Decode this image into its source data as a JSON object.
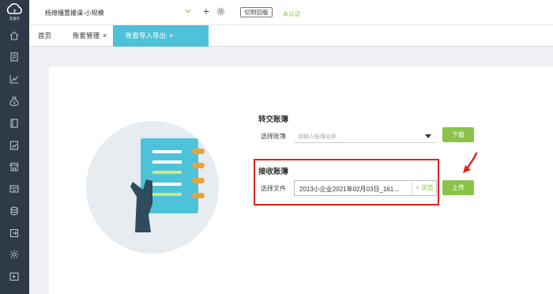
{
  "app": {
    "logo_text": "云会计",
    "company_name": "杨燎橿置擾澡-小规模",
    "old_version_label": "切到旧版",
    "unverified_label": "未认证"
  },
  "sidebar": {
    "icons": [
      "home-icon",
      "voucher-icon",
      "chart-icon",
      "money-bag-icon",
      "book-icon",
      "report-icon",
      "store-icon",
      "asset-icon",
      "coins-icon",
      "export-icon",
      "settings-icon",
      "play-icon"
    ]
  },
  "tabs": [
    {
      "label": "首页",
      "closable": false
    },
    {
      "label": "账套管理",
      "closable": true
    },
    {
      "label": "账套导入导出",
      "closable": true,
      "active": true
    }
  ],
  "transfer": {
    "title": "转交账簿",
    "select_label": "选择账簿",
    "select_placeholder": "请输入账簿名称",
    "download_label": "下载"
  },
  "receive": {
    "title": "接收账簿",
    "file_label": "选择文件",
    "file_value": "2013小企业2021年02月03日_161...",
    "browse_label": "+ 浏览",
    "upload_label": "上传"
  },
  "colors": {
    "sidebar_bg": "#2e3a47",
    "accent_green": "#8bc34a",
    "tab_active": "#4ec2d8",
    "highlight_red": "#e02020"
  }
}
